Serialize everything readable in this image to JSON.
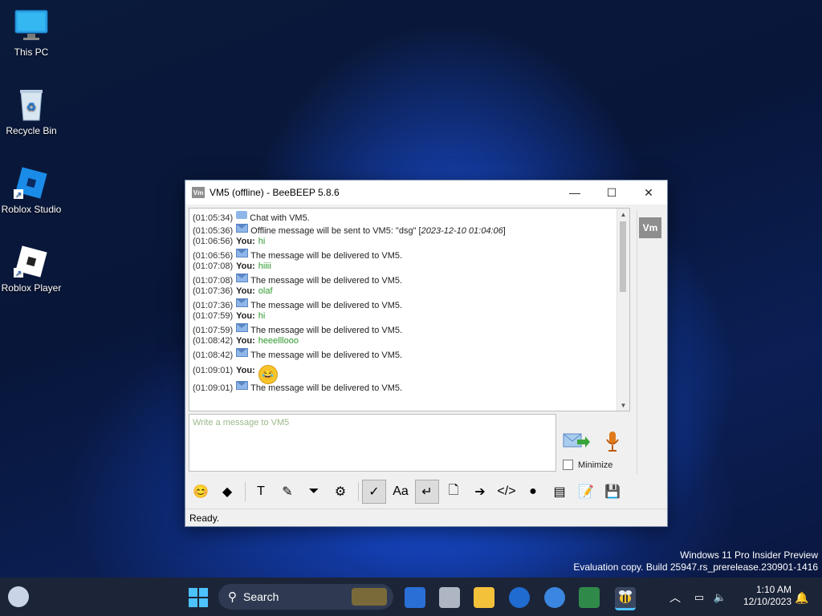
{
  "desktop": {
    "icons": [
      {
        "label": "This PC"
      },
      {
        "label": "Recycle Bin"
      },
      {
        "label": "Roblox Studio"
      },
      {
        "label": "Roblox Player"
      }
    ]
  },
  "window": {
    "title": "VM5 (offline) - BeeBEEP 5.8.6",
    "title_icon": "Vm",
    "controls": {
      "minimize": "—",
      "maximize": "☐",
      "close": "✕"
    }
  },
  "chat": {
    "lines": [
      {
        "time": "(01:05:34)",
        "icon": "bubble-icon",
        "text": "Chat with VM5."
      },
      {
        "time": "(01:05:36)",
        "icon": "envelope-icon",
        "text": "Offline message will be sent to VM5: \"dsg\" [",
        "italic": "2023-12-10 01:04:06",
        "suffix": "]"
      },
      {
        "time": "(01:06:56)",
        "you": "You:",
        "msg": "hi"
      },
      {
        "time": "(01:06:56)",
        "icon": "envelope-icon",
        "text": "The message will be delivered to VM5."
      },
      {
        "time": "(01:07:08)",
        "you": "You:",
        "msg": "hiiii"
      },
      {
        "time": "(01:07:08)",
        "icon": "envelope-icon",
        "text": "The message will be delivered to VM5."
      },
      {
        "time": "(01:07:36)",
        "you": "You:",
        "msg": "olaf"
      },
      {
        "time": "(01:07:36)",
        "icon": "envelope-icon",
        "text": "The message will be delivered to VM5."
      },
      {
        "time": "(01:07:59)",
        "you": "You:",
        "msg": "hi"
      },
      {
        "time": "(01:07:59)",
        "icon": "envelope-icon",
        "text": "The message will be delivered to VM5."
      },
      {
        "time": "(01:08:42)",
        "you": "You:",
        "msg": "heeelllooo"
      },
      {
        "time": "(01:08:42)",
        "icon": "envelope-icon",
        "text": "The message will be delivered to VM5."
      },
      {
        "time": "(01:09:01)",
        "you": "You:",
        "emoji": "😂"
      },
      {
        "time": "(01:09:01)",
        "icon": "envelope-icon",
        "text": "The message will be delivered to VM5."
      }
    ]
  },
  "sidebar": {
    "user_badge": "Vm"
  },
  "composer": {
    "placeholder": "Write a message to VM5",
    "minimize_label": "Minimize"
  },
  "toolbar": {
    "tools": [
      {
        "name": "emoticons-icon",
        "glyph": "😊"
      },
      {
        "name": "gem-icon",
        "glyph": "◆"
      },
      {
        "name": "font-icon",
        "glyph": "T"
      },
      {
        "name": "color-icon",
        "glyph": "✎"
      },
      {
        "name": "filter-icon",
        "glyph": "⏷"
      },
      {
        "name": "settings-icon",
        "glyph": "⚙"
      },
      {
        "name": "spellcheck-icon",
        "glyph": "✓"
      },
      {
        "name": "dictionary-icon",
        "glyph": "Aa"
      },
      {
        "name": "enter-key-icon",
        "glyph": "↵"
      },
      {
        "name": "file-icon",
        "glyph": "🗋"
      },
      {
        "name": "forward-icon",
        "glyph": "➔"
      },
      {
        "name": "html-icon",
        "glyph": "</>"
      },
      {
        "name": "screenshot-icon",
        "glyph": "●"
      },
      {
        "name": "terminal-icon",
        "glyph": "▤"
      },
      {
        "name": "notes-icon",
        "glyph": "📝"
      },
      {
        "name": "save-icon",
        "glyph": "💾"
      }
    ]
  },
  "status": {
    "text": "Ready."
  },
  "taskbar": {
    "search_label": "Search",
    "clock_time": "1:10 AM",
    "clock_date": "12/10/2023"
  },
  "watermark": {
    "line1": "Windows 11 Pro Insider Preview",
    "line2": "Evaluation copy. Build 25947.rs_prerelease.230901-1416"
  },
  "colors": {
    "accent": "#0067c0",
    "message_green": "#2f9a2f",
    "taskbar": "#1c2438"
  }
}
